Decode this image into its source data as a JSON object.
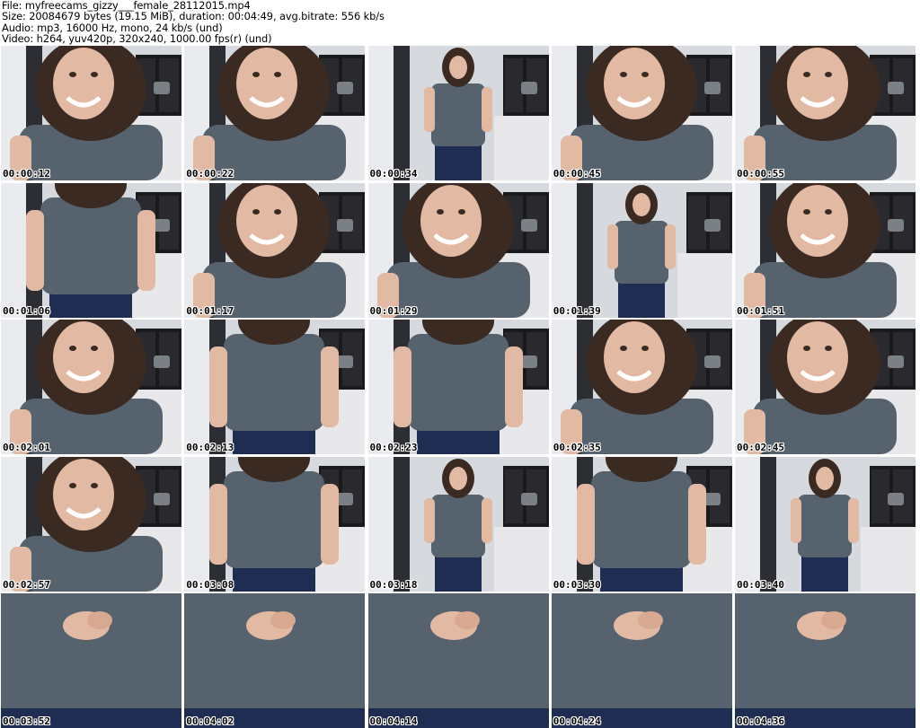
{
  "file_info": {
    "file": "File: myfreecams_gizzy___female_28112015.mp4",
    "size": "Size: 20084679 bytes (19.15 MiB), duration: 00:04:49, avg.bitrate: 556 kb/s",
    "audio": "Audio: mp3, 16000 Hz, mono, 24 kb/s (und)",
    "video": "Video: h264, yuv420p, 320x240, 1000.00 fps(r) (und)"
  },
  "colors": {
    "shirt": "#56636f",
    "hair": "#3a2a22",
    "skin": "#e2b9a3",
    "jeans": "#1f2d52",
    "wall": "#d6d9dd",
    "cabinet": "#1a1a1c",
    "counter": "#e8e8ea"
  },
  "thumbnails": [
    {
      "time": "00:00:12",
      "pose": "closeup"
    },
    {
      "time": "00:00:22",
      "pose": "closeup"
    },
    {
      "time": "00:00:34",
      "pose": "full"
    },
    {
      "time": "00:00:45",
      "pose": "closeup"
    },
    {
      "time": "00:00:55",
      "pose": "closeup"
    },
    {
      "time": "00:01:06",
      "pose": "torso"
    },
    {
      "time": "00:01:17",
      "pose": "closeup"
    },
    {
      "time": "00:01:29",
      "pose": "closeup"
    },
    {
      "time": "00:01:39",
      "pose": "full"
    },
    {
      "time": "00:01:51",
      "pose": "closeup"
    },
    {
      "time": "00:02:01",
      "pose": "closeup"
    },
    {
      "time": "00:02:13",
      "pose": "torso"
    },
    {
      "time": "00:02:23",
      "pose": "torso"
    },
    {
      "time": "00:02:35",
      "pose": "closeup"
    },
    {
      "time": "00:02:45",
      "pose": "closeup"
    },
    {
      "time": "00:02:57",
      "pose": "closeup"
    },
    {
      "time": "00:03:08",
      "pose": "torso"
    },
    {
      "time": "00:03:18",
      "pose": "full"
    },
    {
      "time": "00:03:30",
      "pose": "torso"
    },
    {
      "time": "00:03:40",
      "pose": "full"
    },
    {
      "time": "00:03:52",
      "pose": "shirt"
    },
    {
      "time": "00:04:02",
      "pose": "shirt"
    },
    {
      "time": "00:04:14",
      "pose": "shirt"
    },
    {
      "time": "00:04:24",
      "pose": "shirt"
    },
    {
      "time": "00:04:36",
      "pose": "shirt"
    }
  ]
}
